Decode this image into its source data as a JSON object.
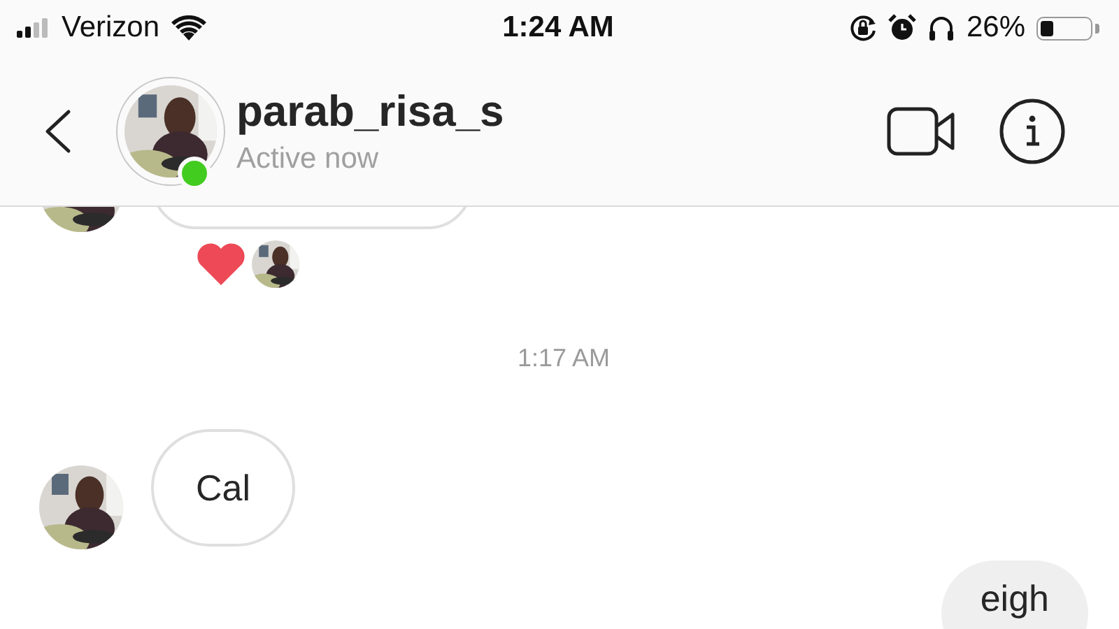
{
  "status_bar": {
    "carrier": "Verizon",
    "time": "1:24 AM",
    "battery_percent": "26%"
  },
  "header": {
    "username": "parab_risa_s",
    "status": "Active now",
    "online": true
  },
  "messages": [
    {
      "kind": "incoming",
      "cut": true,
      "reactions": [
        {
          "kind": "heart"
        }
      ]
    },
    {
      "kind": "timestamp",
      "text": "1:17 AM"
    },
    {
      "kind": "incoming",
      "text": "Cal"
    },
    {
      "kind": "outgoing",
      "text": "eigh"
    }
  ]
}
